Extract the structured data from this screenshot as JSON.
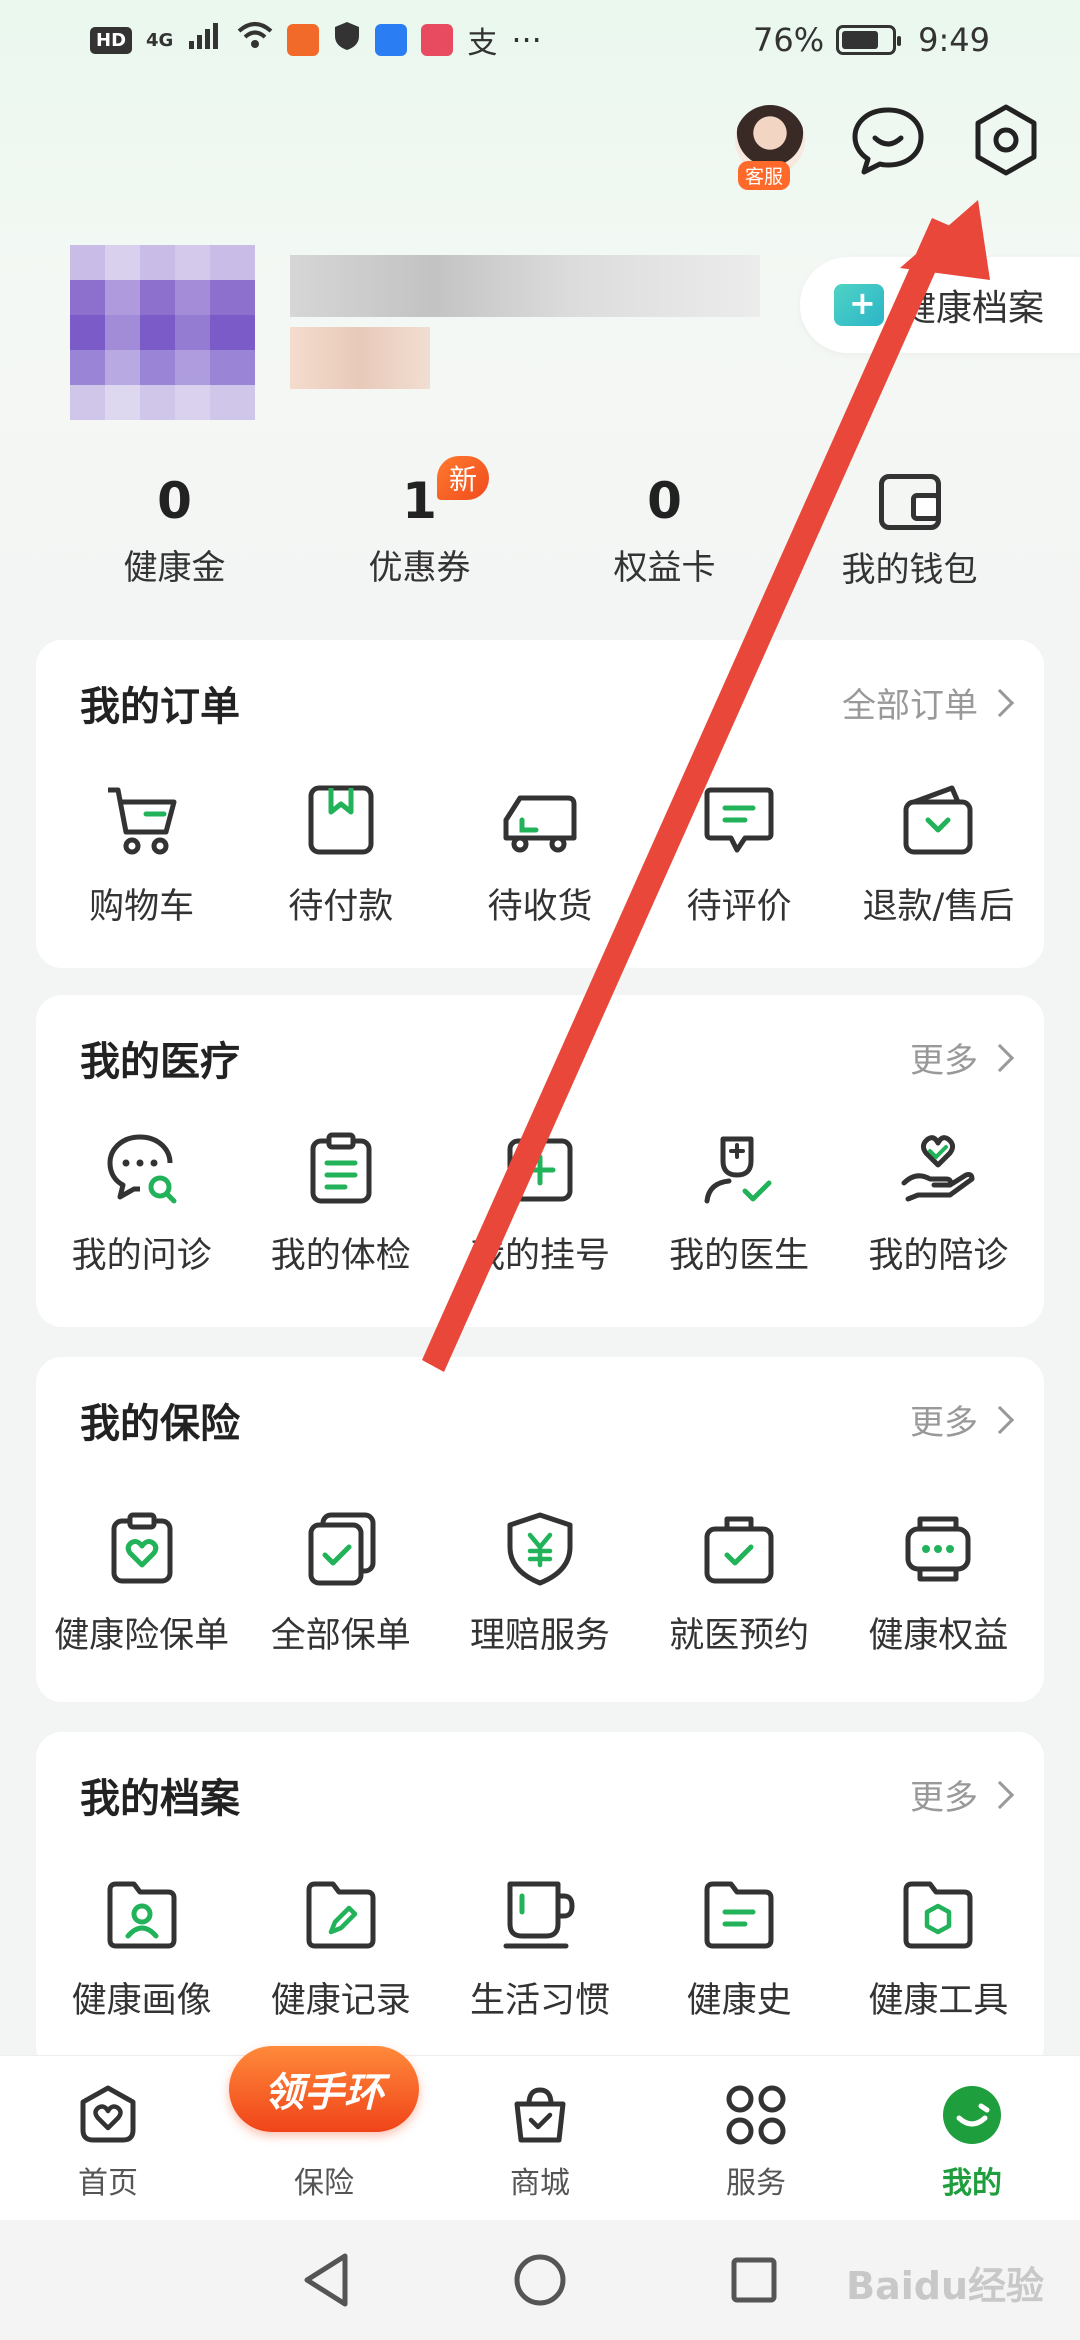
{
  "status_bar": {
    "hd": "HD",
    "net": "4G",
    "alipay": "支",
    "more": "···",
    "battery": "76%",
    "battery_level": 0.76,
    "time": "9:49"
  },
  "top": {
    "customer_service_badge": "客服"
  },
  "profile": {
    "health_file_label": "健康档案"
  },
  "stats": [
    {
      "value": "0",
      "label": "健康金"
    },
    {
      "value": "1",
      "label": "优惠券",
      "badge": "新"
    },
    {
      "value": "0",
      "label": "权益卡"
    },
    {
      "label": "我的钱包"
    }
  ],
  "orders": {
    "title": "我的订单",
    "more": "全部订单",
    "items": [
      {
        "label": "购物车",
        "icon": "cart-icon"
      },
      {
        "label": "待付款",
        "icon": "wallet-pending-icon"
      },
      {
        "label": "待收货",
        "icon": "truck-icon"
      },
      {
        "label": "待评价",
        "icon": "comment-icon"
      },
      {
        "label": "退款/售后",
        "icon": "refund-icon"
      }
    ]
  },
  "medical": {
    "title": "我的医疗",
    "more": "更多",
    "items": [
      {
        "label": "我的问诊",
        "icon": "consult-icon"
      },
      {
        "label": "我的体检",
        "icon": "checkup-icon"
      },
      {
        "label": "我的挂号",
        "icon": "registration-icon"
      },
      {
        "label": "我的医生",
        "icon": "doctor-icon"
      },
      {
        "label": "我的陪诊",
        "icon": "escort-icon"
      }
    ]
  },
  "insurance": {
    "title": "我的保险",
    "more": "更多",
    "items": [
      {
        "label": "健康险保单",
        "icon": "policy-icon"
      },
      {
        "label": "全部保单",
        "icon": "all-policies-icon"
      },
      {
        "label": "理赔服务",
        "icon": "claim-icon"
      },
      {
        "label": "就医预约",
        "icon": "appointment-icon"
      },
      {
        "label": "健康权益",
        "icon": "benefit-icon"
      }
    ]
  },
  "archive": {
    "title": "我的档案",
    "more": "更多",
    "items": [
      {
        "label": "健康画像",
        "icon": "portrait-icon"
      },
      {
        "label": "健康记录",
        "icon": "record-icon"
      },
      {
        "label": "生活习惯",
        "icon": "habit-icon"
      },
      {
        "label": "健康史",
        "icon": "history-icon"
      },
      {
        "label": "健康工具",
        "icon": "tools-icon"
      }
    ]
  },
  "bottom_nav": {
    "items": [
      {
        "label": "首页"
      },
      {
        "label": "保险",
        "promo": "领手环"
      },
      {
        "label": "商城"
      },
      {
        "label": "服务"
      },
      {
        "label": "我的",
        "active": true
      }
    ]
  },
  "colors": {
    "accent": "#1f9e3d",
    "arrow": "#e8473a",
    "promo": "#f0441a"
  },
  "watermark": "Baidu经验"
}
